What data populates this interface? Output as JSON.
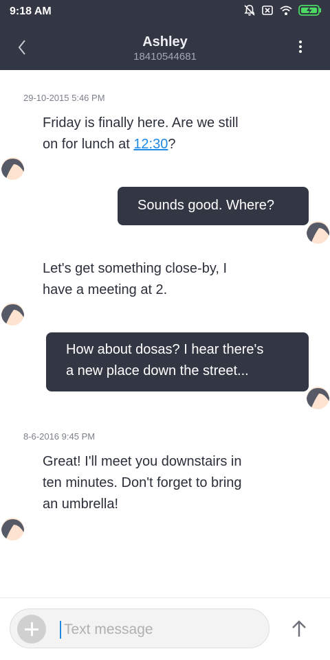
{
  "status_bar": {
    "time": "9:18 AM"
  },
  "header": {
    "contact_name": "Ashley",
    "contact_number": "18410544681"
  },
  "conversation": {
    "timestamps": [
      "29-10-2015 5:46 PM",
      "8-6-2016 9:45 PM"
    ],
    "messages": [
      {
        "direction": "incoming",
        "line1": "Friday is finally here. Are we still",
        "line2_prefix": "on for lunch at ",
        "line2_link": "12:30",
        "line2_suffix": "?"
      },
      {
        "direction": "outgoing",
        "text": "Sounds good. Where?"
      },
      {
        "direction": "incoming",
        "line1": "Let's get something close-by, I",
        "line2": "have a meeting at 2."
      },
      {
        "direction": "outgoing",
        "line1": "How about dosas? I hear there's",
        "line2": "a new place down the street..."
      },
      {
        "direction": "incoming",
        "line1": "Great! I'll meet you downstairs in",
        "line2": "ten minutes. Don't forget to bring",
        "line3": "an umbrella!"
      }
    ]
  },
  "composer": {
    "placeholder": "Text message"
  },
  "colors": {
    "header_bg": "#333643",
    "bubble_out": "#333643",
    "link": "#1e88e5"
  }
}
